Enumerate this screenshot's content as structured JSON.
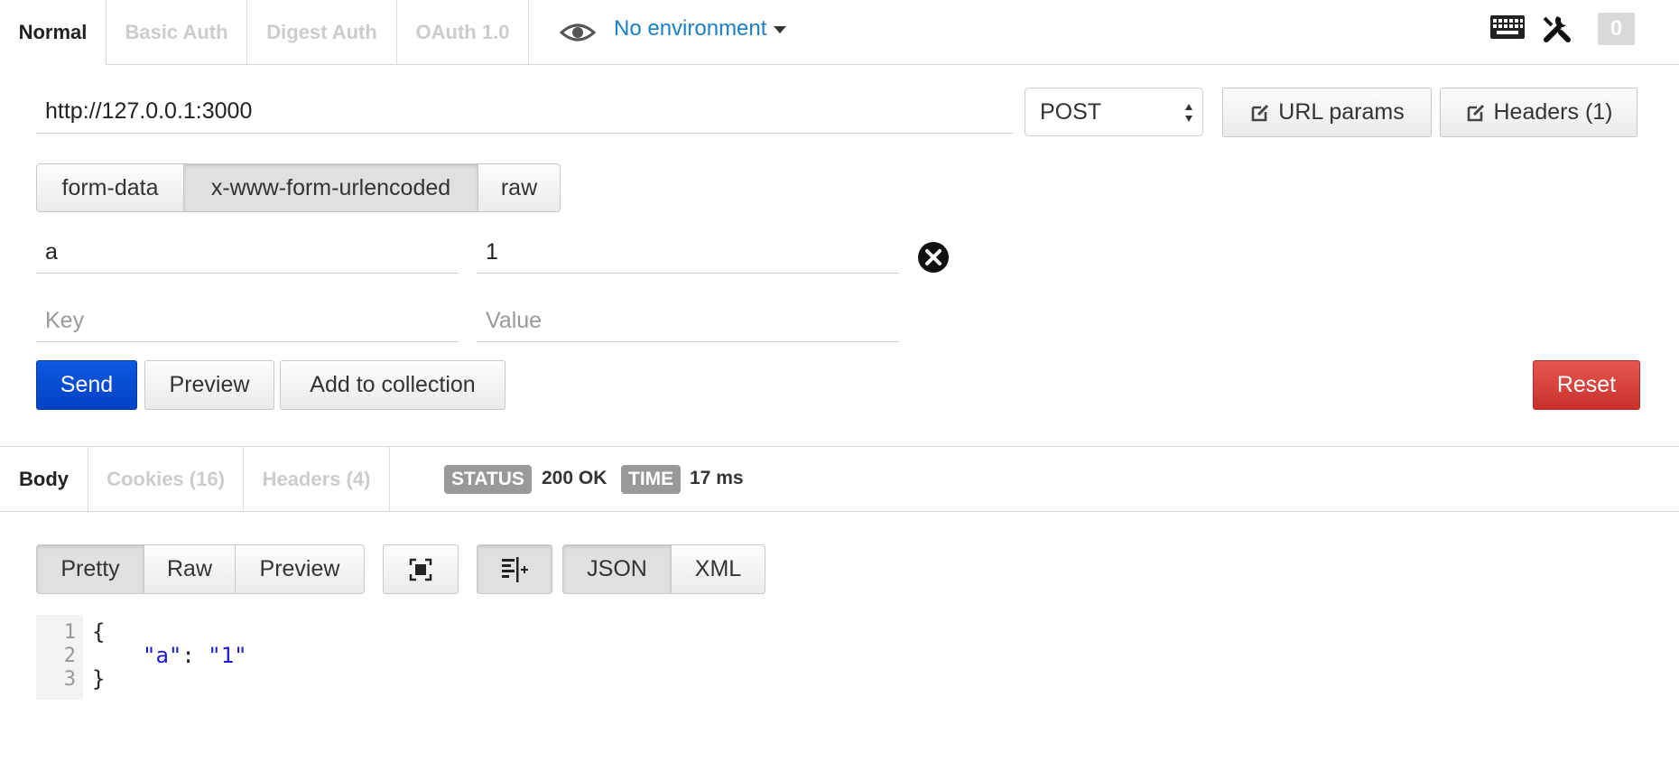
{
  "auth_tabs": [
    {
      "label": "Normal",
      "active": true
    },
    {
      "label": "Basic Auth",
      "active": false
    },
    {
      "label": "Digest Auth",
      "active": false
    },
    {
      "label": "OAuth 1.0",
      "active": false
    }
  ],
  "environment": {
    "label": "No environment",
    "icon": "eye-icon"
  },
  "toolbar_icons": [
    "keyboard-icon",
    "wrench-icon"
  ],
  "notification_count": "0",
  "request": {
    "url": "http://127.0.0.1:3000",
    "method": "POST",
    "url_params_label": "URL params",
    "headers_label": "Headers (1)"
  },
  "body_types": [
    {
      "label": "form-data",
      "active": false
    },
    {
      "label": "x-www-form-urlencoded",
      "active": true
    },
    {
      "label": "raw",
      "active": false
    }
  ],
  "params": [
    {
      "key": "a",
      "value": "1"
    }
  ],
  "new_param": {
    "key_placeholder": "Key",
    "value_placeholder": "Value"
  },
  "actions": {
    "send": "Send",
    "preview": "Preview",
    "add_to_collection": "Add to collection",
    "reset": "Reset"
  },
  "response_tabs": [
    {
      "label": "Body",
      "active": true
    },
    {
      "label": "Cookies (16)",
      "active": false
    },
    {
      "label": "Headers (4)",
      "active": false
    }
  ],
  "status": {
    "label": "STATUS",
    "value": "200 OK"
  },
  "time": {
    "label": "TIME",
    "value": "17 ms"
  },
  "view_modes": [
    {
      "label": "Pretty",
      "active": true
    },
    {
      "label": "Raw",
      "active": false
    },
    {
      "label": "Preview",
      "active": false
    }
  ],
  "formats": [
    {
      "label": "JSON",
      "active": true
    },
    {
      "label": "XML",
      "active": false
    }
  ],
  "response_body": {
    "line_numbers": [
      "1",
      "2",
      "3"
    ],
    "open_brace": "{",
    "key": "\"a\"",
    "colon": ": ",
    "value": "\"1\"",
    "close_brace": "}"
  },
  "colors": {
    "send": "#0441c4",
    "reset": "#c9302c",
    "env_link": "#1a7fc4",
    "status_label": "#999999"
  }
}
